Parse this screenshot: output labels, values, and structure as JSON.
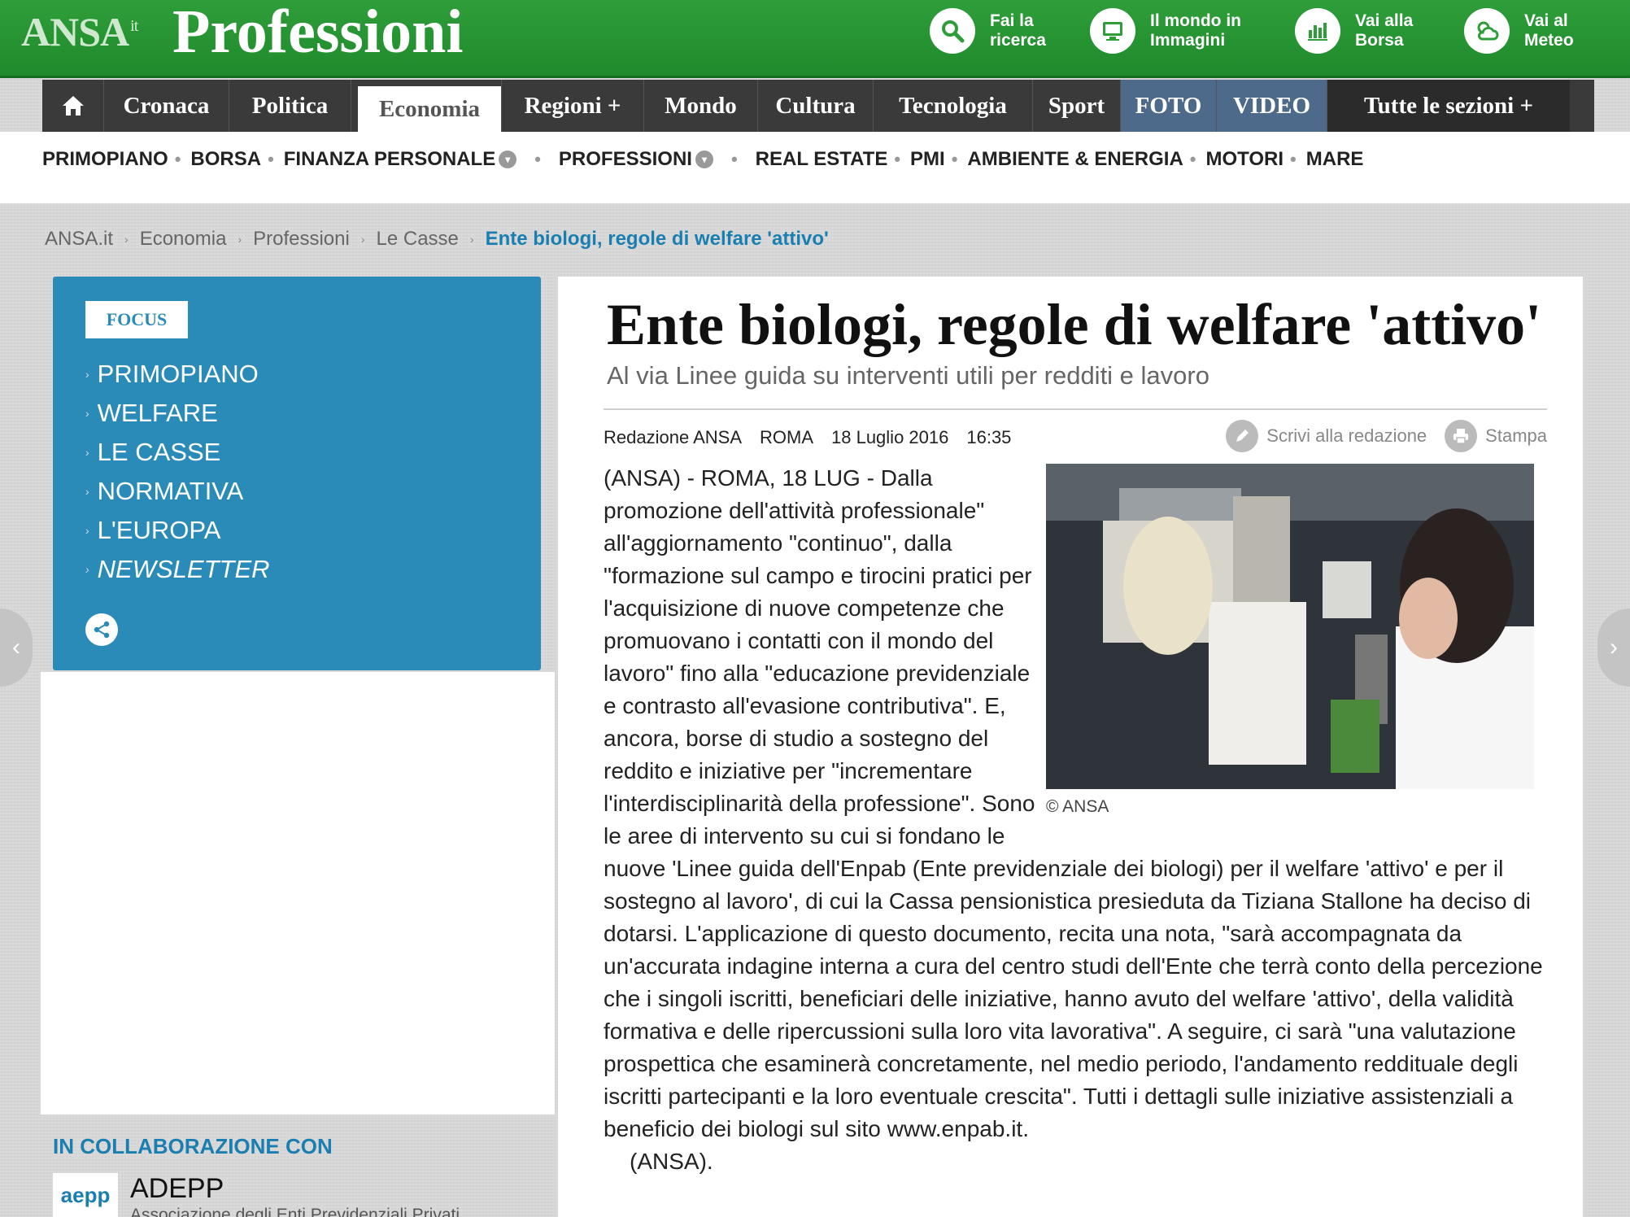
{
  "header": {
    "logo_ansa": "ANSA",
    "logo_ansa_suffix": "it",
    "logo_section": "Professioni",
    "quick_links": [
      {
        "label_line1": "Fai la",
        "label_line2": "ricerca",
        "icon": "search-icon"
      },
      {
        "label_line1": "Il mondo in",
        "label_line2": "Immagini",
        "icon": "monitor-icon"
      },
      {
        "label_line1": "Vai alla",
        "label_line2": "Borsa",
        "icon": "chart-icon"
      },
      {
        "label_line1": "Vai al",
        "label_line2": "Meteo",
        "icon": "weather-icon"
      }
    ]
  },
  "mainnav": {
    "items": [
      {
        "label": "Cronaca"
      },
      {
        "label": "Politica"
      },
      {
        "label": "Economia"
      },
      {
        "label": "Regioni +"
      },
      {
        "label": "Mondo"
      },
      {
        "label": "Cultura"
      },
      {
        "label": "Tecnologia"
      },
      {
        "label": "Sport"
      },
      {
        "label": "FOTO"
      },
      {
        "label": "VIDEO"
      },
      {
        "label": "Tutte le sezioni +"
      }
    ]
  },
  "subnav": {
    "items": [
      {
        "label": "PRIMOPIANO"
      },
      {
        "label": "BORSA"
      },
      {
        "label": "FINANZA PERSONALE"
      },
      {
        "label": "PROFESSIONI"
      },
      {
        "label": "REAL ESTATE"
      },
      {
        "label": "PMI"
      },
      {
        "label": "AMBIENTE & ENERGIA"
      },
      {
        "label": "MOTORI"
      },
      {
        "label": "MARE"
      }
    ]
  },
  "breadcrumb": {
    "items": [
      "ANSA.it",
      "Economia",
      "Professioni",
      "Le Casse"
    ],
    "current": "Ente biologi, regole di welfare 'attivo'"
  },
  "focus": {
    "badge": "FOCUS",
    "items": [
      "PRIMOPIANO",
      "WELFARE",
      "LE CASSE",
      "NORMATIVA",
      "L'EUROPA",
      "NEWSLETTER"
    ]
  },
  "collab": {
    "title": "IN COLLABORAZIONE CON",
    "logo_text": "aepp",
    "name": "ADEPP",
    "subtitle": "Associazione degli Enti Previdenziali Privati"
  },
  "article": {
    "headline": "Ente biologi, regole di welfare 'attivo'",
    "subtitle": "Al via Linee guida su interventi utili per redditi e lavoro",
    "author": "Redazione ANSA",
    "place": "ROMA",
    "date": "18 Luglio 2016",
    "time": "16:35",
    "write_label": "Scrivi alla redazione",
    "print_label": "Stampa",
    "photo_credit": "© ANSA",
    "body": "(ANSA) - ROMA, 18 LUG - Dalla promozione dell'attività professionale\" all'aggiornamento \"continuo\", dalla \"formazione sul campo e tirocini pratici per l'acquisizione di nuove competenze che promuovano i contatti con il mondo del lavoro\" fino alla \"educazione previdenziale e contrasto all'evasione contributiva\". E, ancora, borse di studio a sostegno del reddito e iniziative per \"incrementare l'interdisciplinarità della professione\". Sono le aree di intervento su cui si fondano le nuove 'Linee guida dell'Enpab (Ente previdenziale dei biologi) per il welfare 'attivo' e per il sostegno al lavoro', di cui la Cassa pensionistica presieduta da Tiziana Stallone ha deciso di dotarsi. L'applicazione di questo documento, recita una nota, \"sarà accompagnata da un'accurata indagine interna a cura del centro studi dell'Ente che terrà conto della percezione che i singoli iscritti, beneficiari delle iniziative, hanno avuto del welfare 'attivo', della validità formativa e delle ripercussioni sulla loro vita lavorativa\". A seguire, ci sarà \"una valutazione prospettica che esaminerà concretamente, nel medio periodo, l'andamento reddituale degli iscritti partecipanti e la loro eventuale crescita\". Tutti i dettagli sulle iniziative assistenziali a beneficio dei biologi sul sito www.enpab.it.",
    "signature": "(ANSA)."
  },
  "colors": {
    "header_green": "#2f9e3a",
    "nav_dark": "#3a3a3a",
    "focus_blue": "#2a8ab8",
    "link_blue": "#1a7fb0"
  }
}
